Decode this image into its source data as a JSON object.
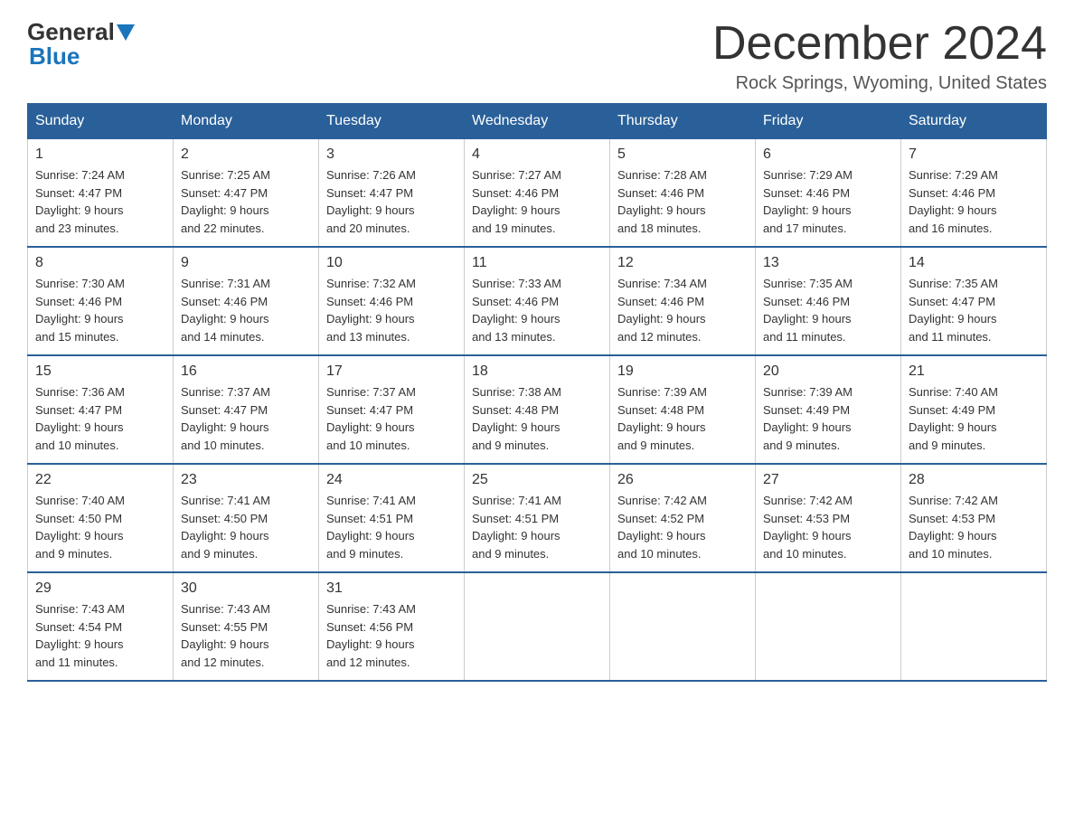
{
  "header": {
    "logo_general": "General",
    "logo_blue": "Blue",
    "month_title": "December 2024",
    "location": "Rock Springs, Wyoming, United States"
  },
  "weekdays": [
    "Sunday",
    "Monday",
    "Tuesday",
    "Wednesday",
    "Thursday",
    "Friday",
    "Saturday"
  ],
  "weeks": [
    [
      {
        "day": "1",
        "sunrise": "7:24 AM",
        "sunset": "4:47 PM",
        "daylight": "9 hours and 23 minutes."
      },
      {
        "day": "2",
        "sunrise": "7:25 AM",
        "sunset": "4:47 PM",
        "daylight": "9 hours and 22 minutes."
      },
      {
        "day": "3",
        "sunrise": "7:26 AM",
        "sunset": "4:47 PM",
        "daylight": "9 hours and 20 minutes."
      },
      {
        "day": "4",
        "sunrise": "7:27 AM",
        "sunset": "4:46 PM",
        "daylight": "9 hours and 19 minutes."
      },
      {
        "day": "5",
        "sunrise": "7:28 AM",
        "sunset": "4:46 PM",
        "daylight": "9 hours and 18 minutes."
      },
      {
        "day": "6",
        "sunrise": "7:29 AM",
        "sunset": "4:46 PM",
        "daylight": "9 hours and 17 minutes."
      },
      {
        "day": "7",
        "sunrise": "7:29 AM",
        "sunset": "4:46 PM",
        "daylight": "9 hours and 16 minutes."
      }
    ],
    [
      {
        "day": "8",
        "sunrise": "7:30 AM",
        "sunset": "4:46 PM",
        "daylight": "9 hours and 15 minutes."
      },
      {
        "day": "9",
        "sunrise": "7:31 AM",
        "sunset": "4:46 PM",
        "daylight": "9 hours and 14 minutes."
      },
      {
        "day": "10",
        "sunrise": "7:32 AM",
        "sunset": "4:46 PM",
        "daylight": "9 hours and 13 minutes."
      },
      {
        "day": "11",
        "sunrise": "7:33 AM",
        "sunset": "4:46 PM",
        "daylight": "9 hours and 13 minutes."
      },
      {
        "day": "12",
        "sunrise": "7:34 AM",
        "sunset": "4:46 PM",
        "daylight": "9 hours and 12 minutes."
      },
      {
        "day": "13",
        "sunrise": "7:35 AM",
        "sunset": "4:46 PM",
        "daylight": "9 hours and 11 minutes."
      },
      {
        "day": "14",
        "sunrise": "7:35 AM",
        "sunset": "4:47 PM",
        "daylight": "9 hours and 11 minutes."
      }
    ],
    [
      {
        "day": "15",
        "sunrise": "7:36 AM",
        "sunset": "4:47 PM",
        "daylight": "9 hours and 10 minutes."
      },
      {
        "day": "16",
        "sunrise": "7:37 AM",
        "sunset": "4:47 PM",
        "daylight": "9 hours and 10 minutes."
      },
      {
        "day": "17",
        "sunrise": "7:37 AM",
        "sunset": "4:47 PM",
        "daylight": "9 hours and 10 minutes."
      },
      {
        "day": "18",
        "sunrise": "7:38 AM",
        "sunset": "4:48 PM",
        "daylight": "9 hours and 9 minutes."
      },
      {
        "day": "19",
        "sunrise": "7:39 AM",
        "sunset": "4:48 PM",
        "daylight": "9 hours and 9 minutes."
      },
      {
        "day": "20",
        "sunrise": "7:39 AM",
        "sunset": "4:49 PM",
        "daylight": "9 hours and 9 minutes."
      },
      {
        "day": "21",
        "sunrise": "7:40 AM",
        "sunset": "4:49 PM",
        "daylight": "9 hours and 9 minutes."
      }
    ],
    [
      {
        "day": "22",
        "sunrise": "7:40 AM",
        "sunset": "4:50 PM",
        "daylight": "9 hours and 9 minutes."
      },
      {
        "day": "23",
        "sunrise": "7:41 AM",
        "sunset": "4:50 PM",
        "daylight": "9 hours and 9 minutes."
      },
      {
        "day": "24",
        "sunrise": "7:41 AM",
        "sunset": "4:51 PM",
        "daylight": "9 hours and 9 minutes."
      },
      {
        "day": "25",
        "sunrise": "7:41 AM",
        "sunset": "4:51 PM",
        "daylight": "9 hours and 9 minutes."
      },
      {
        "day": "26",
        "sunrise": "7:42 AM",
        "sunset": "4:52 PM",
        "daylight": "9 hours and 10 minutes."
      },
      {
        "day": "27",
        "sunrise": "7:42 AM",
        "sunset": "4:53 PM",
        "daylight": "9 hours and 10 minutes."
      },
      {
        "day": "28",
        "sunrise": "7:42 AM",
        "sunset": "4:53 PM",
        "daylight": "9 hours and 10 minutes."
      }
    ],
    [
      {
        "day": "29",
        "sunrise": "7:43 AM",
        "sunset": "4:54 PM",
        "daylight": "9 hours and 11 minutes."
      },
      {
        "day": "30",
        "sunrise": "7:43 AM",
        "sunset": "4:55 PM",
        "daylight": "9 hours and 12 minutes."
      },
      {
        "day": "31",
        "sunrise": "7:43 AM",
        "sunset": "4:56 PM",
        "daylight": "9 hours and 12 minutes."
      },
      null,
      null,
      null,
      null
    ]
  ]
}
